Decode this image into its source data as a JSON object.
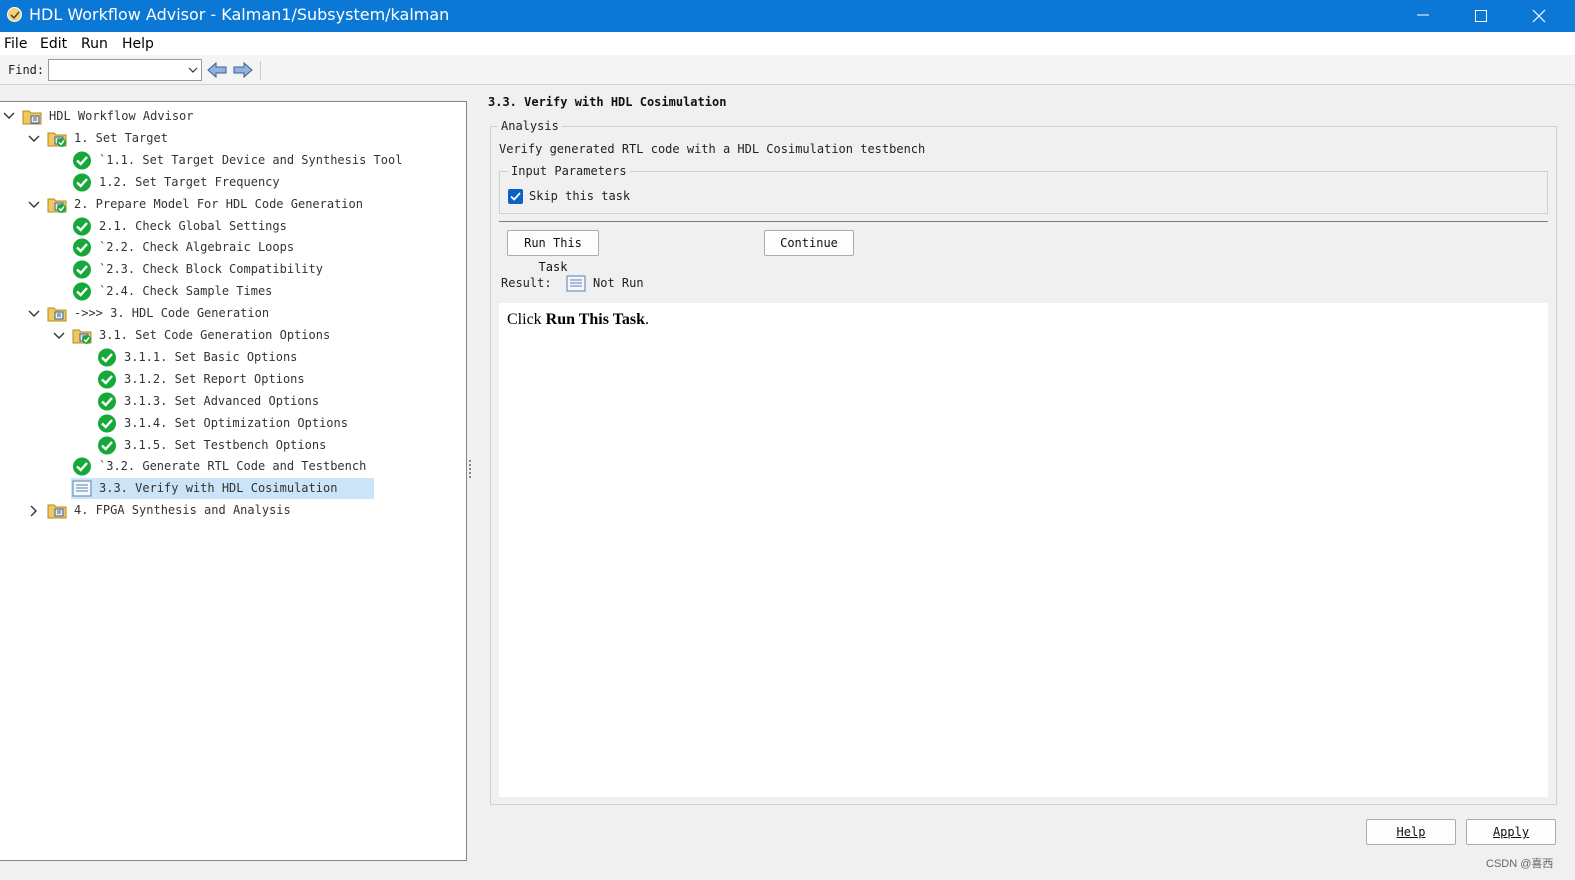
{
  "window": {
    "title": "HDL Workflow Advisor - Kalman1/Subsystem/kalman"
  },
  "menu": [
    "File",
    "Edit",
    "Run",
    "Help"
  ],
  "toolbar": {
    "find_label": "Find:",
    "find_value": ""
  },
  "tree": {
    "root": "HDL Workflow Advisor",
    "items": [
      {
        "label": "1. Set Target",
        "status": "folder-passed",
        "expanded": true
      },
      {
        "label": "`1.1. Set Target Device and Synthesis Tool",
        "status": "passed"
      },
      {
        "label": "1.2. Set Target Frequency",
        "status": "passed"
      },
      {
        "label": "2. Prepare Model For HDL Code Generation",
        "status": "folder-passed",
        "expanded": true
      },
      {
        "label": "2.1. Check Global Settings",
        "status": "passed"
      },
      {
        "label": "`2.2. Check Algebraic Loops",
        "status": "passed"
      },
      {
        "label": "`2.3. Check Block Compatibility",
        "status": "passed"
      },
      {
        "label": "`2.4. Check Sample Times",
        "status": "passed"
      },
      {
        "label": "->>> 3. HDL Code Generation",
        "status": "folder",
        "expanded": true
      },
      {
        "label": "3.1. Set Code Generation Options",
        "status": "folder-passed",
        "expanded": true
      },
      {
        "label": "3.1.1. Set Basic Options",
        "status": "passed"
      },
      {
        "label": "3.1.2. Set Report Options",
        "status": "passed"
      },
      {
        "label": "3.1.3. Set Advanced Options",
        "status": "passed"
      },
      {
        "label": "3.1.4. Set Optimization Options",
        "status": "passed"
      },
      {
        "label": "3.1.5. Set Testbench Options",
        "status": "passed"
      },
      {
        "label": "`3.2. Generate RTL Code and Testbench",
        "status": "passed"
      },
      {
        "label": "3.3. Verify with HDL Cosimulation",
        "status": "not-run",
        "selected": true
      },
      {
        "label": "4. FPGA Synthesis and Analysis",
        "status": "folder",
        "expanded": false
      }
    ]
  },
  "task": {
    "title": "3.3. Verify with HDL Cosimulation",
    "analysis_legend": "Analysis",
    "analysis_desc": "Verify generated RTL code with a HDL Cosimulation testbench",
    "params_legend": "Input Parameters",
    "skip_label": "Skip this task",
    "skip_checked": true,
    "run_button": "Run This Task",
    "continue_button": "Continue",
    "result_label": "Result:",
    "result_value": "Not Run",
    "report_prefix": "Click ",
    "report_bold": "Run This Task",
    "report_suffix": "."
  },
  "footer": {
    "help_button": "Help",
    "apply_button": "Apply"
  },
  "watermark": "CSDN @喜西",
  "colors": {
    "titlebar": "#0a78d4",
    "selection": "#cce4f7",
    "passed_green": "#17a83a"
  }
}
